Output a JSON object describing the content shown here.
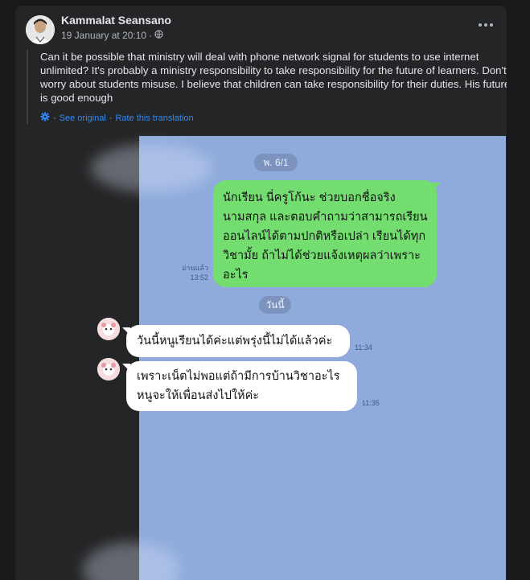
{
  "post": {
    "author": "Kammalat Seansano",
    "date": "19 January at 20:10",
    "dot": "·",
    "body": "Can it be possible that ministry will deal with phone network signal for students to use internet unlimited? It's probably a ministry responsibility to take responsibility for the future of learners. Don't worry about students misuse. I believe that children can take responsibility for their duties. His future is good enough",
    "see_original": "See original",
    "separator": "·",
    "rate_translation": "Rate this translation",
    "icons": {
      "more": "more-options-icon",
      "privacy": "globe-icon",
      "translate": "gear-icon"
    }
  },
  "chat": {
    "date_pill_1": "พ. 6/1",
    "outgoing_text": "นักเรียน นี่ครูโก้นะ ช่วยบอกชื่อจริง นามสกุล และตอบคำถามว่าสามารถเรียนออนไลน์ได้ตามปกติหรือเปล่า เรียนได้ทุกวิชามั้ย ถ้าไม่ได้ช่วยแจ้งเหตุผลว่าเพราะอะไร",
    "read_label": "อ่านแล้ว",
    "read_time": "13:52",
    "date_pill_2": "วันนี้",
    "incoming_1": "วันนี้หนูเรียนได้ค่ะแต่พรุ่งนี้ไม่ได้แล้วค่ะ",
    "time_1": "11:34",
    "incoming_2": "เพราะเน็ตไม่พอแต่ถ้ามีการบ้านวิชาอะไร หนูจะให้เพื่อนส่งไปให้ค่ะ",
    "time_2": "11:35"
  },
  "colors": {
    "page_bg": "#18191a",
    "card_bg": "#242526",
    "chat_bg": "#8fabdc",
    "outgoing_bubble": "#73de6f",
    "incoming_bubble": "#ffffff",
    "link": "#2e89ff"
  }
}
